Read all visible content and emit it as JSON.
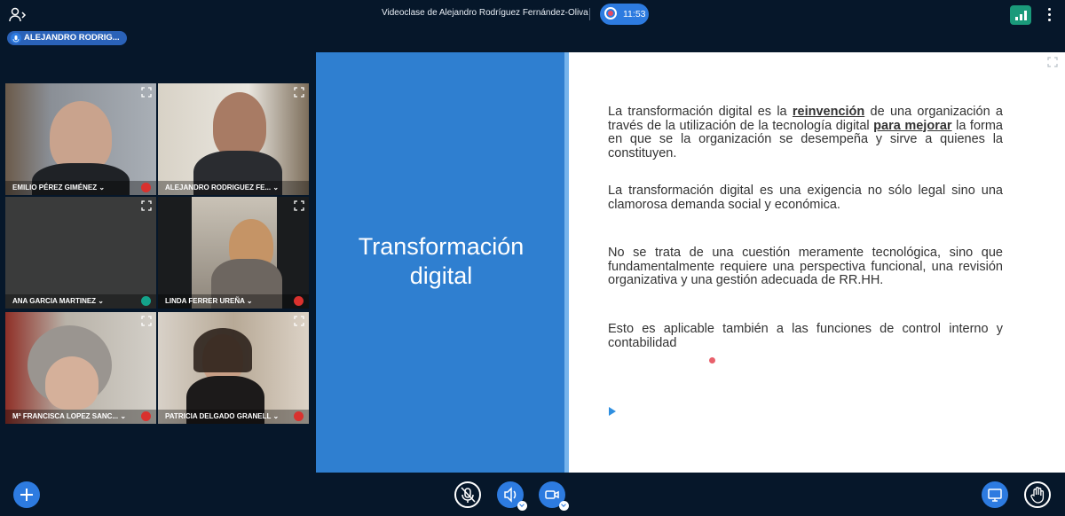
{
  "header": {
    "title": "Videoclase de Alejandro Rodríguez Fernández-Oliva",
    "recording_time": "11:53",
    "icons": [
      "users-icon",
      "record-icon",
      "connection-status-icon",
      "more-options-icon"
    ]
  },
  "presenter": {
    "label": "ALEJANDRO RODRIG..."
  },
  "participants": [
    {
      "name": "EMILIO PÉREZ GIMÉNEZ ⌄",
      "status": "muted"
    },
    {
      "name": "ALEJANDRO RODRIGUEZ FE... ⌄",
      "status": "active-speaker"
    },
    {
      "name": "ANA GARCIA MARTINEZ ⌄",
      "status": "listen-only"
    },
    {
      "name": "LINDA FERRER UREÑA ⌄",
      "status": "muted"
    },
    {
      "name": "Mª FRANCISCA LOPEZ SANC... ⌄",
      "status": "muted"
    },
    {
      "name": "PATRICIA DELGADO GRANELL ⌄",
      "status": "muted"
    }
  ],
  "slide": {
    "title_line1": "Transformación",
    "title_line2": "digital",
    "p1_a": "La transformación digital es la ",
    "p1_b": "reinvención",
    "p1_c": " de una organización a través de la utilización de la tecnología digital ",
    "p1_d": "para mejorar",
    "p1_e": " la forma en que se la organización se desempeña y sirve a quienes la constituyen.",
    "p2": "La transformación digital es una exigencia no sólo legal sino una clamorosa demanda social y económica.",
    "p3": "No se trata de una cuestión meramente tecnológica, sino que fundamentalmente requiere una perspectiva funcional, una revisión organizativa y una gestión adecuada de RR.HH.",
    "p4": "Esto es aplicable también a las funciones de control interno y contabilidad"
  },
  "colors": {
    "background": "#06172a",
    "accent": "#2d7be0",
    "slide_blue": "#2f7fd0",
    "muted_red": "#d9312e",
    "listen_green": "#14a38b"
  },
  "controls": [
    "add-action-button",
    "mute-button",
    "audio-button",
    "camera-button",
    "share-screen-button",
    "raise-hand-button"
  ]
}
